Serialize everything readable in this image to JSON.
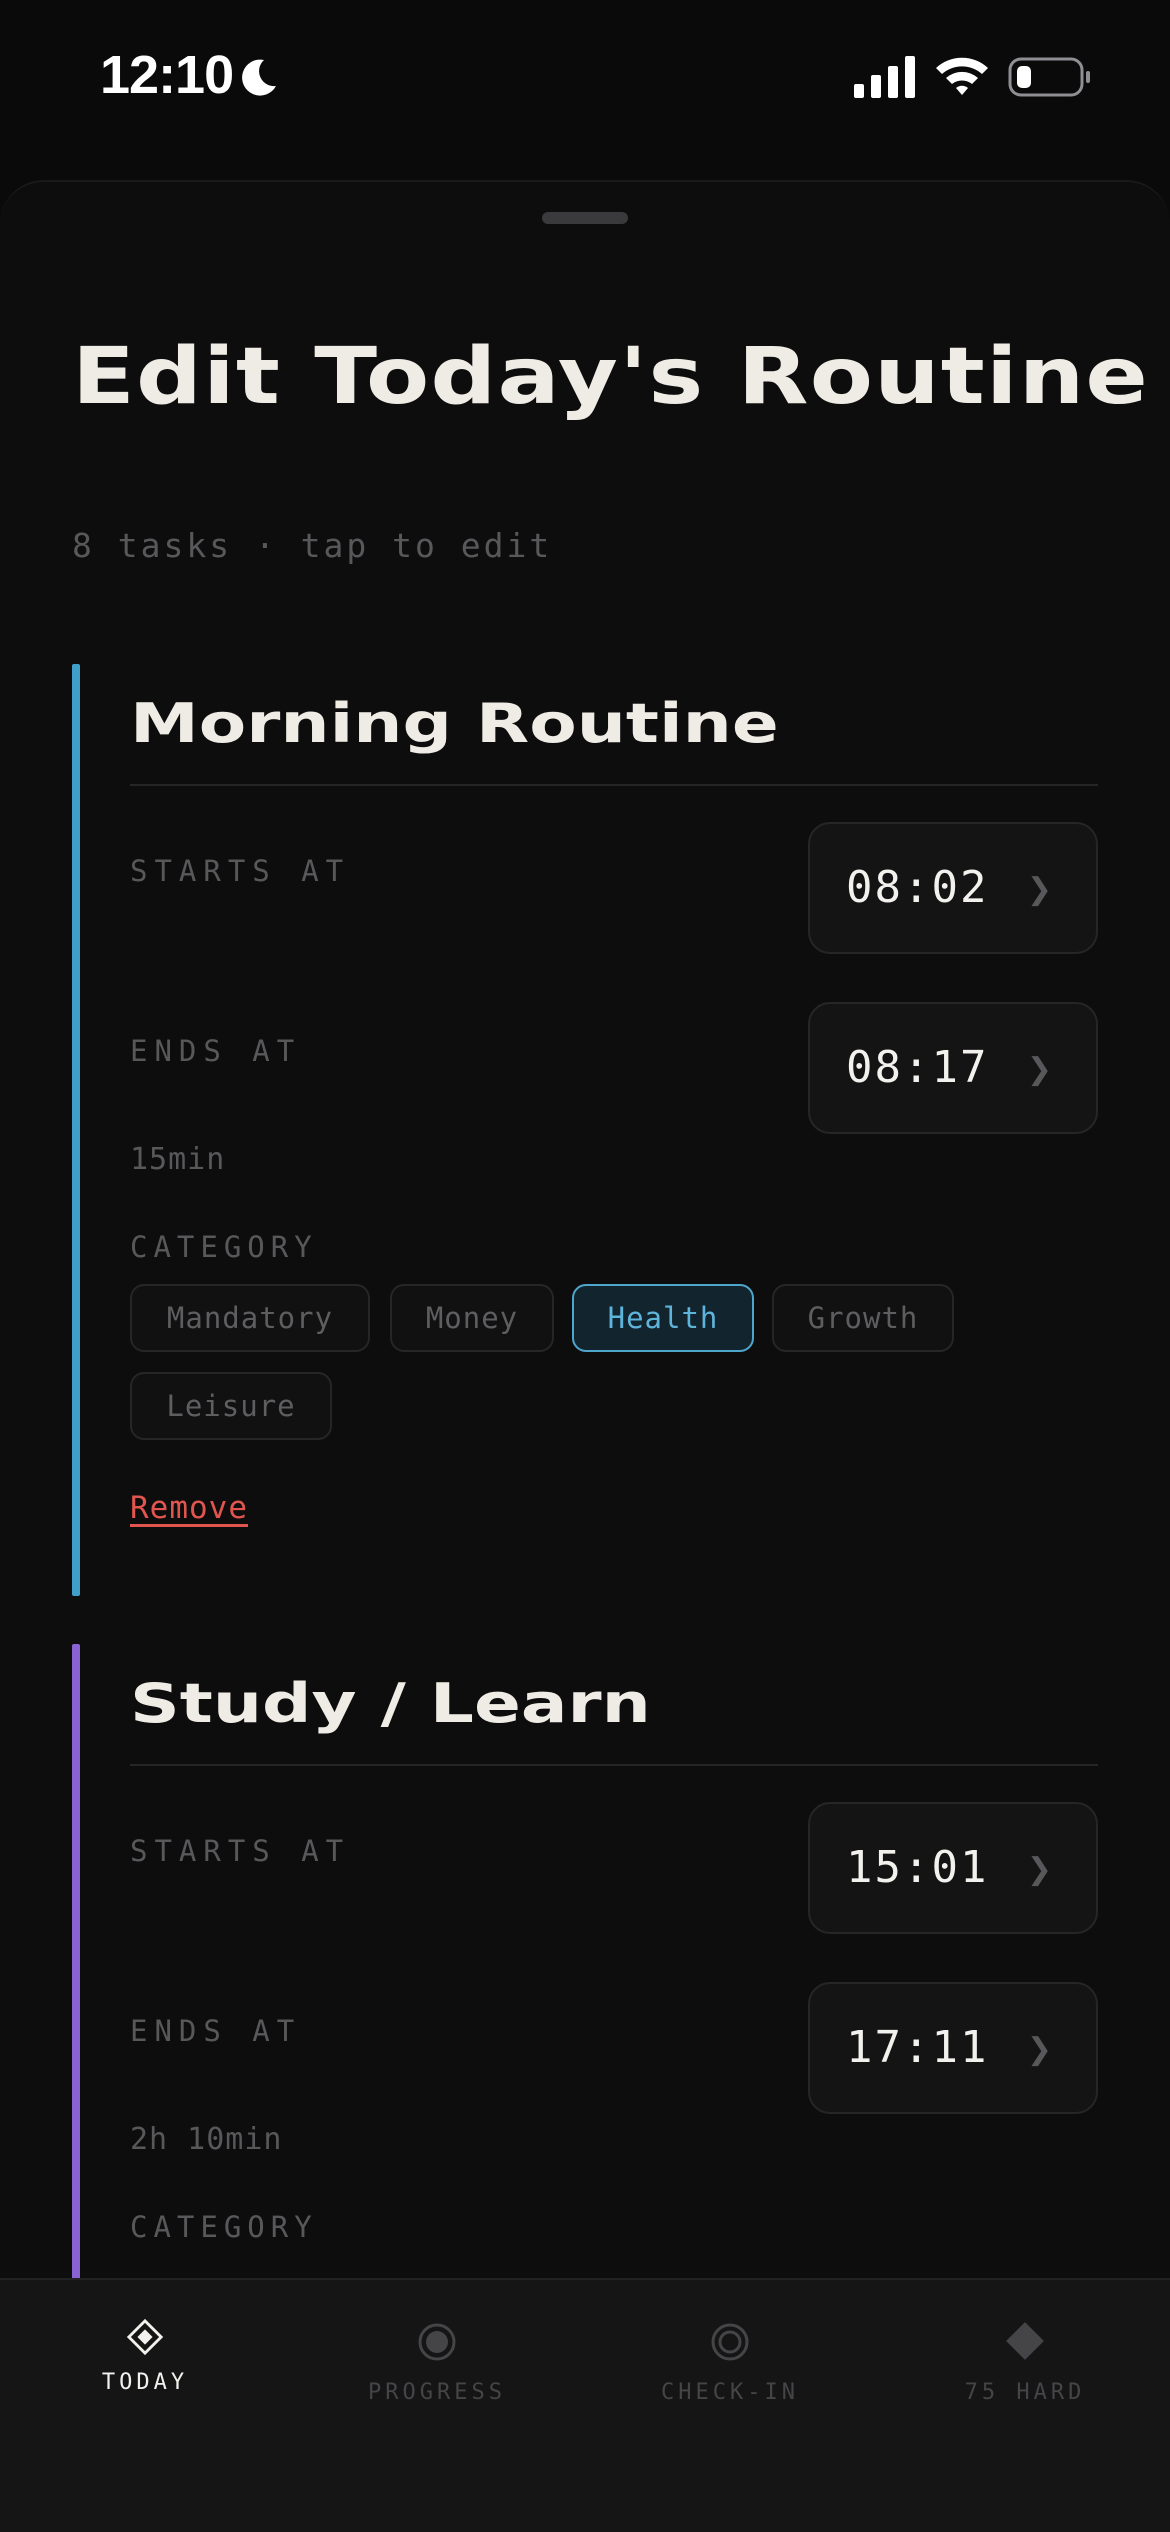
{
  "status_bar": {
    "time": "12:10"
  },
  "header": {
    "title": "Edit Today's Routine",
    "subtitle": "8 tasks · tap to edit"
  },
  "tasks": [
    {
      "title": "Morning Routine",
      "accent_color": "#3f9fc8",
      "starts_label": "STARTS AT",
      "starts_value": "08:02",
      "ends_label": "ENDS AT",
      "ends_value": "08:17",
      "duration": "15min",
      "category_label": "CATEGORY",
      "categories": [
        "Mandatory",
        "Money",
        "Health",
        "Growth",
        "Leisure"
      ],
      "selected_category": "Health",
      "remove_label": "Remove"
    },
    {
      "title": "Study / Learn",
      "accent_color": "#8a63d2",
      "starts_label": "STARTS AT",
      "starts_value": "15:01",
      "ends_label": "ENDS AT",
      "ends_value": "17:11",
      "duration": "2h 10min",
      "category_label": "CATEGORY"
    }
  ],
  "tab_bar": {
    "tabs": [
      {
        "label": "TODAY",
        "icon": "diamond-outline-icon",
        "active": true
      },
      {
        "label": "PROGRESS",
        "icon": "circle-dot-icon",
        "active": false
      },
      {
        "label": "CHECK-IN",
        "icon": "ring-icon",
        "active": false
      },
      {
        "label": "75 HARD",
        "icon": "diamond-solid-icon",
        "active": false
      }
    ]
  },
  "colors": {
    "background": "#0a0a0a",
    "sheet": "#0d0d0e",
    "selected_chip": "#4ea6cc",
    "remove": "#e0564f"
  }
}
